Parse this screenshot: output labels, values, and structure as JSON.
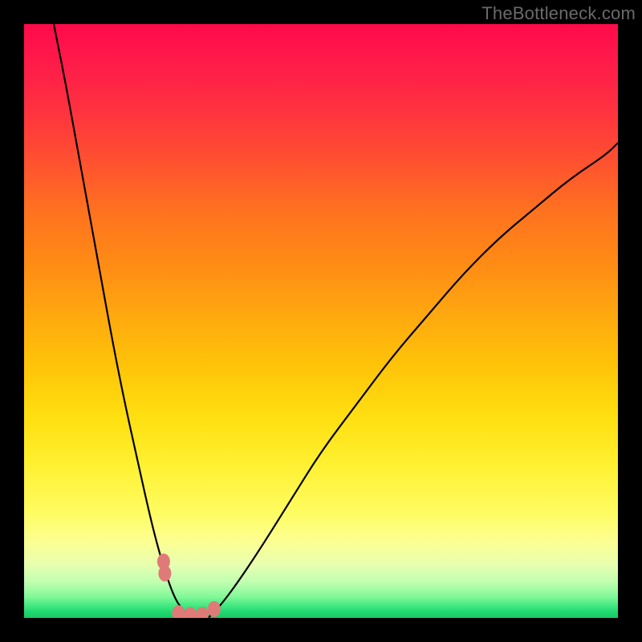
{
  "watermark": {
    "text": "TheBottleneck.com"
  },
  "colors": {
    "background": "#000000",
    "curve_stroke": "#000000",
    "dot_fill": "#e07a78",
    "gradient_top": "#ff0a4a",
    "gradient_bottom": "#18c866"
  },
  "chart_data": {
    "type": "line",
    "title": "",
    "xlabel": "",
    "ylabel": "",
    "xlim": [
      0,
      100
    ],
    "ylim": [
      0,
      100
    ],
    "grid": false,
    "series": [
      {
        "name": "left-branch",
        "x": [
          5,
          7,
          9,
          11,
          13,
          15,
          17,
          19,
          21,
          22.5,
          24,
          25.5,
          27,
          28
        ],
        "values": [
          100,
          90,
          79,
          68,
          57,
          46,
          36,
          27,
          18,
          12,
          7,
          3,
          1,
          0
        ]
      },
      {
        "name": "right-branch",
        "x": [
          31,
          33,
          36,
          40,
          45,
          50,
          56,
          62,
          68,
          74,
          80,
          86,
          92,
          98,
          100
        ],
        "values": [
          0,
          2,
          6,
          12,
          20,
          28,
          36,
          44,
          51,
          58,
          64,
          69,
          74,
          78,
          80
        ]
      }
    ],
    "markers": {
      "name": "highlight-dots",
      "x": [
        23.5,
        23.7,
        26.0,
        28.0,
        30.0,
        32.0
      ],
      "values": [
        9.5,
        7.5,
        0.8,
        0.5,
        0.5,
        1.5
      ]
    },
    "notes": "x and y are in percent of plot area; y=0 at bottom (green), y=100 at top (red). Curve is a V-shaped bottleneck profile with minimum near x≈28–31."
  }
}
